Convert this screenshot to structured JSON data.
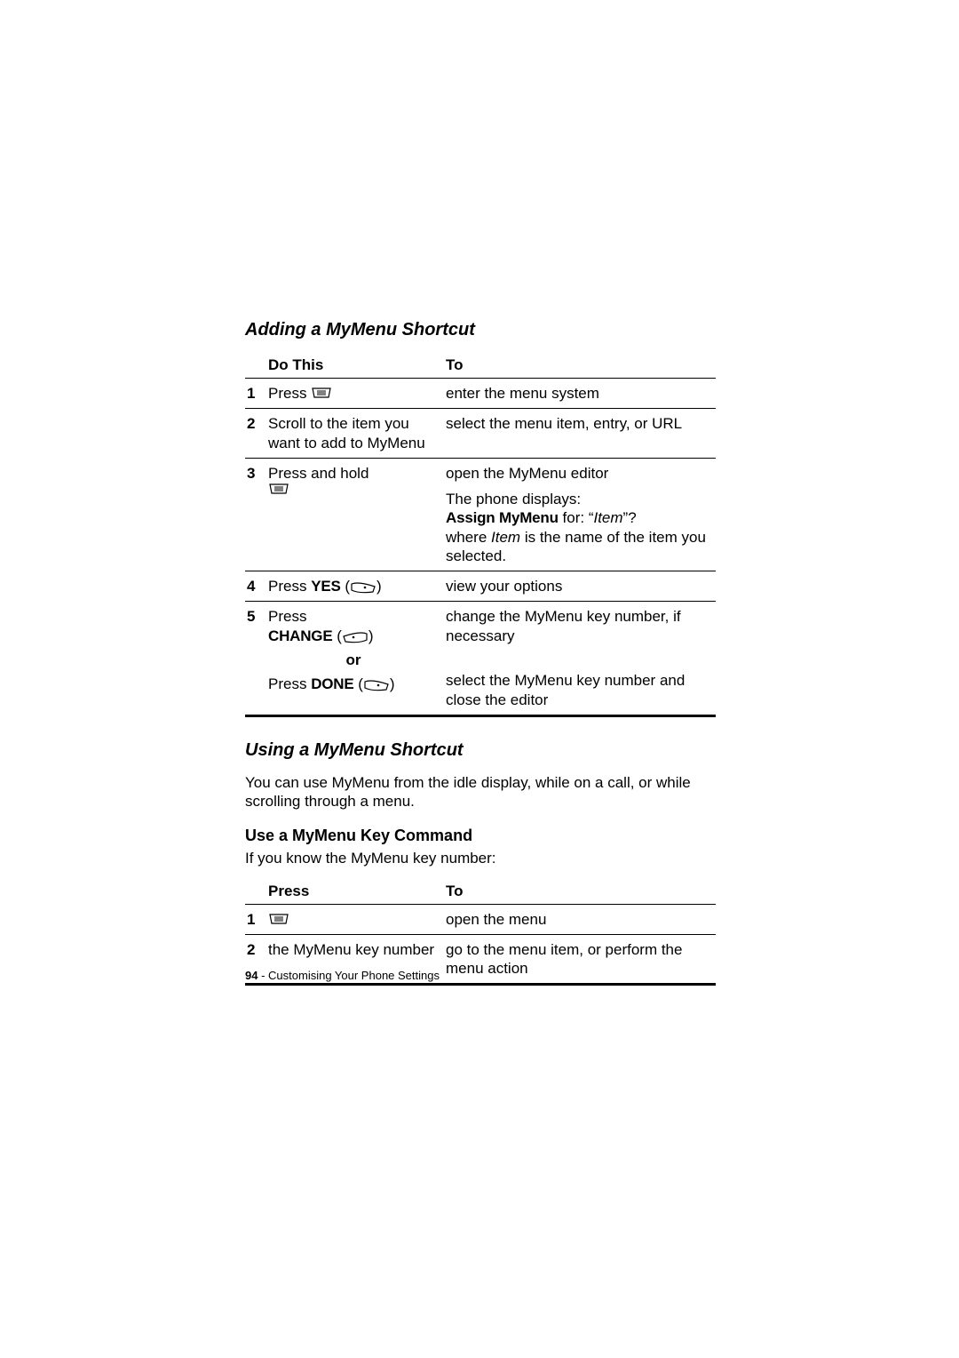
{
  "section1": {
    "heading": "Adding a MyMenu Shortcut",
    "table": {
      "head_left": "Do This",
      "head_right": "To",
      "rows": [
        {
          "n": "1",
          "left_prefix": "Press ",
          "right": "enter the menu system"
        },
        {
          "n": "2",
          "left": "Scroll to the item you want to add to MyMenu",
          "right": "select the menu item, entry, or URL"
        },
        {
          "n": "3",
          "left_prefix": "Press and hold",
          "right_line1": "open the MyMenu editor",
          "right_line2a": "The phone displays:",
          "right_line2b_bold": "Assign MyMenu",
          "right_line2b_mid": " for: “",
          "right_line2b_ital": "Item",
          "right_line2b_end": "”?",
          "right_line2c_a": "where ",
          "right_line2c_ital": "Item",
          "right_line2c_b": " is the name of the item you selected."
        },
        {
          "n": "4",
          "left_prefix": "Press ",
          "left_bold": "YES",
          "right": "view your options"
        },
        {
          "n": "5",
          "left_a_prefix": "Press",
          "left_a_bold": "CHANGE",
          "left_or": "or",
          "left_b_prefix": "Press ",
          "left_b_bold": "DONE",
          "right_a": "change the MyMenu key number, if necessary",
          "right_b": "select the MyMenu key number and close the editor"
        }
      ]
    }
  },
  "section2": {
    "heading": "Using a MyMenu Shortcut",
    "intro": "You can use MyMenu from the idle display, while on a call, or while scrolling through a menu.",
    "sub_heading": "Use a MyMenu Key Command",
    "sub_intro": "If you know the MyMenu key number:",
    "table": {
      "head_left": "Press",
      "head_right": "To",
      "rows": [
        {
          "n": "1",
          "right": "open the menu"
        },
        {
          "n": "2",
          "left": "the MyMenu key number",
          "right": "go to the menu item, or perform the menu action"
        }
      ]
    }
  },
  "footer": {
    "page_num": "94",
    "sep": " - ",
    "title": "Customising Your Phone Settings"
  }
}
